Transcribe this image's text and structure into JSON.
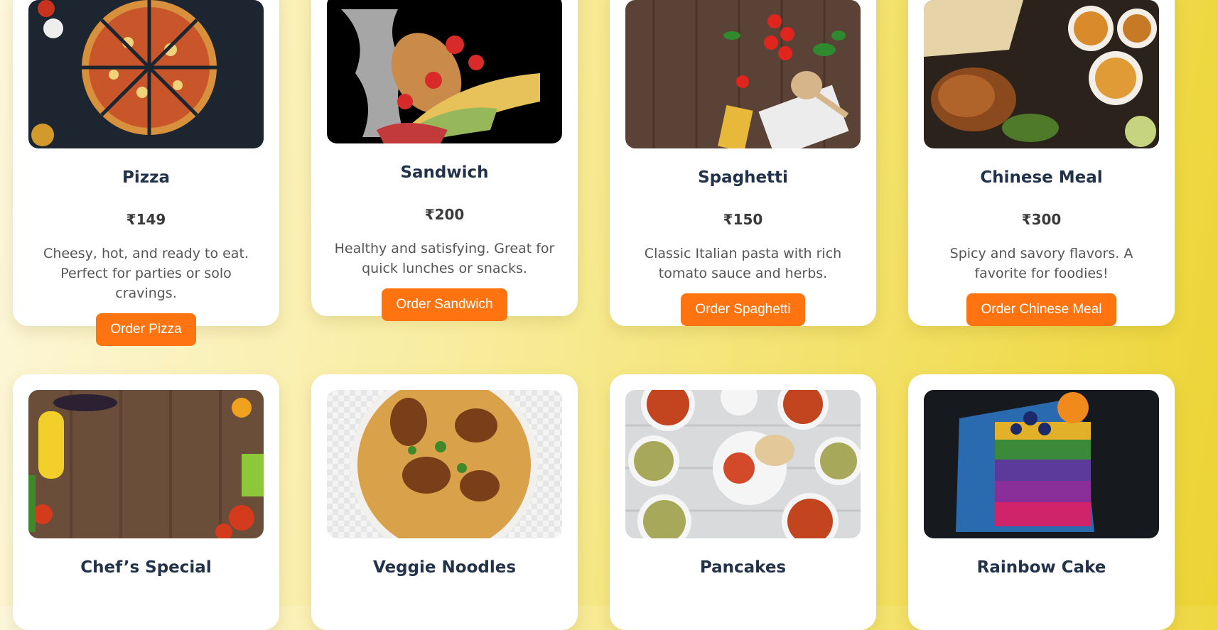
{
  "row1": [
    {
      "title": "Pizza",
      "price": "₹149",
      "desc": "Cheesy, hot, and ready to eat. Perfect for parties or solo cravings.",
      "button": "Order Pizza"
    },
    {
      "title": "Sandwich",
      "price": "₹200",
      "desc": "Healthy and satisfying. Great for quick lunches or snacks.",
      "button": "Order Sandwich"
    },
    {
      "title": "Spaghetti",
      "price": "₹150",
      "desc": "Classic Italian pasta with rich tomato sauce and herbs.",
      "button": "Order Spaghetti"
    },
    {
      "title": "Chinese Meal",
      "price": "₹300",
      "desc": "Spicy and savory flavors. A favorite for foodies!",
      "button": "Order Chinese Meal"
    }
  ],
  "row2": [
    {
      "title": "Chef’s Special"
    },
    {
      "title": "Veggie Noodles"
    },
    {
      "title": "Pancakes"
    },
    {
      "title": "Rainbow Cake"
    }
  ],
  "colors": {
    "accent": "#ff7410",
    "title": "#22324a"
  }
}
